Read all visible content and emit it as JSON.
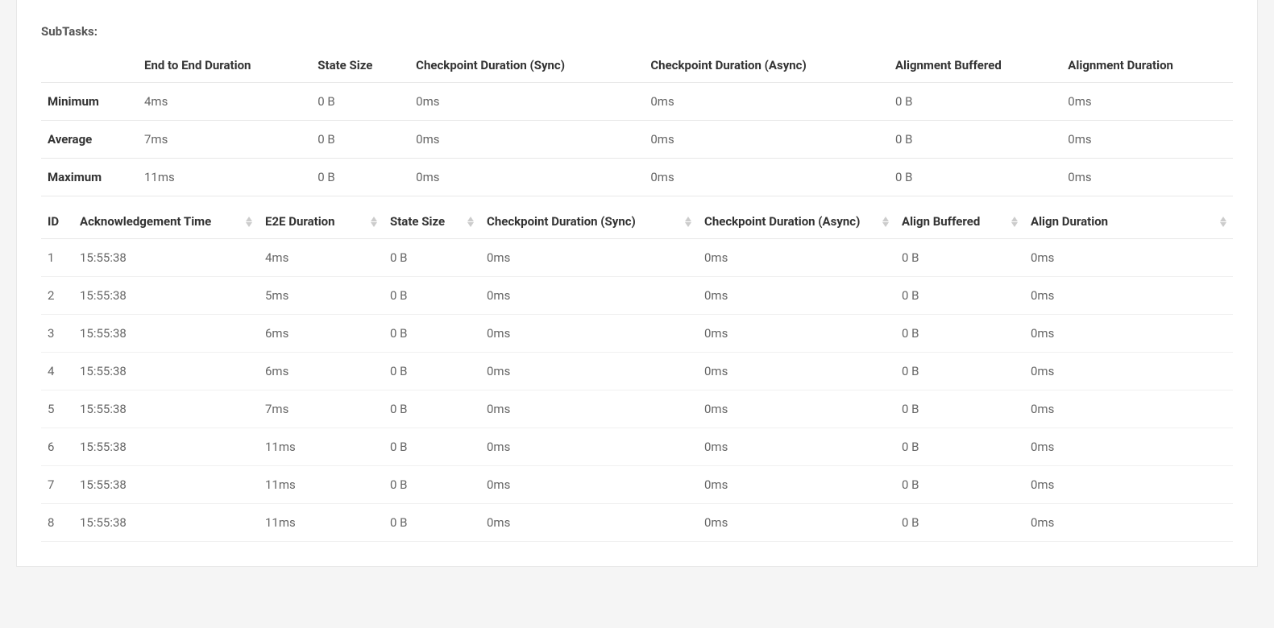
{
  "sectionTitle": "SubTasks:",
  "summary": {
    "headers": [
      "",
      "End to End Duration",
      "State Size",
      "Checkpoint Duration (Sync)",
      "Checkpoint Duration (Async)",
      "Alignment Buffered",
      "Alignment Duration"
    ],
    "rows": [
      {
        "label": "Minimum",
        "values": [
          "4ms",
          "0 B",
          "0ms",
          "0ms",
          "0 B",
          "0ms"
        ]
      },
      {
        "label": "Average",
        "values": [
          "7ms",
          "0 B",
          "0ms",
          "0ms",
          "0 B",
          "0ms"
        ]
      },
      {
        "label": "Maximum",
        "values": [
          "11ms",
          "0 B",
          "0ms",
          "0ms",
          "0 B",
          "0ms"
        ]
      }
    ]
  },
  "detail": {
    "headers": [
      {
        "label": "ID",
        "sortable": false
      },
      {
        "label": "Acknowledgement Time",
        "sortable": true
      },
      {
        "label": "E2E Duration",
        "sortable": true
      },
      {
        "label": "State Size",
        "sortable": true
      },
      {
        "label": "Checkpoint Duration (Sync)",
        "sortable": true
      },
      {
        "label": "Checkpoint Duration (Async)",
        "sortable": true
      },
      {
        "label": "Align Buffered",
        "sortable": true
      },
      {
        "label": "Align Duration",
        "sortable": true
      }
    ],
    "rows": [
      {
        "id": "1",
        "ack": "15:55:38",
        "e2e": "4ms",
        "state": "0 B",
        "sync": "0ms",
        "async": "0ms",
        "buf": "0 B",
        "dur": "0ms"
      },
      {
        "id": "2",
        "ack": "15:55:38",
        "e2e": "5ms",
        "state": "0 B",
        "sync": "0ms",
        "async": "0ms",
        "buf": "0 B",
        "dur": "0ms"
      },
      {
        "id": "3",
        "ack": "15:55:38",
        "e2e": "6ms",
        "state": "0 B",
        "sync": "0ms",
        "async": "0ms",
        "buf": "0 B",
        "dur": "0ms"
      },
      {
        "id": "4",
        "ack": "15:55:38",
        "e2e": "6ms",
        "state": "0 B",
        "sync": "0ms",
        "async": "0ms",
        "buf": "0 B",
        "dur": "0ms"
      },
      {
        "id": "5",
        "ack": "15:55:38",
        "e2e": "7ms",
        "state": "0 B",
        "sync": "0ms",
        "async": "0ms",
        "buf": "0 B",
        "dur": "0ms"
      },
      {
        "id": "6",
        "ack": "15:55:38",
        "e2e": "11ms",
        "state": "0 B",
        "sync": "0ms",
        "async": "0ms",
        "buf": "0 B",
        "dur": "0ms"
      },
      {
        "id": "7",
        "ack": "15:55:38",
        "e2e": "11ms",
        "state": "0 B",
        "sync": "0ms",
        "async": "0ms",
        "buf": "0 B",
        "dur": "0ms"
      },
      {
        "id": "8",
        "ack": "15:55:38",
        "e2e": "11ms",
        "state": "0 B",
        "sync": "0ms",
        "async": "0ms",
        "buf": "0 B",
        "dur": "0ms"
      }
    ]
  }
}
